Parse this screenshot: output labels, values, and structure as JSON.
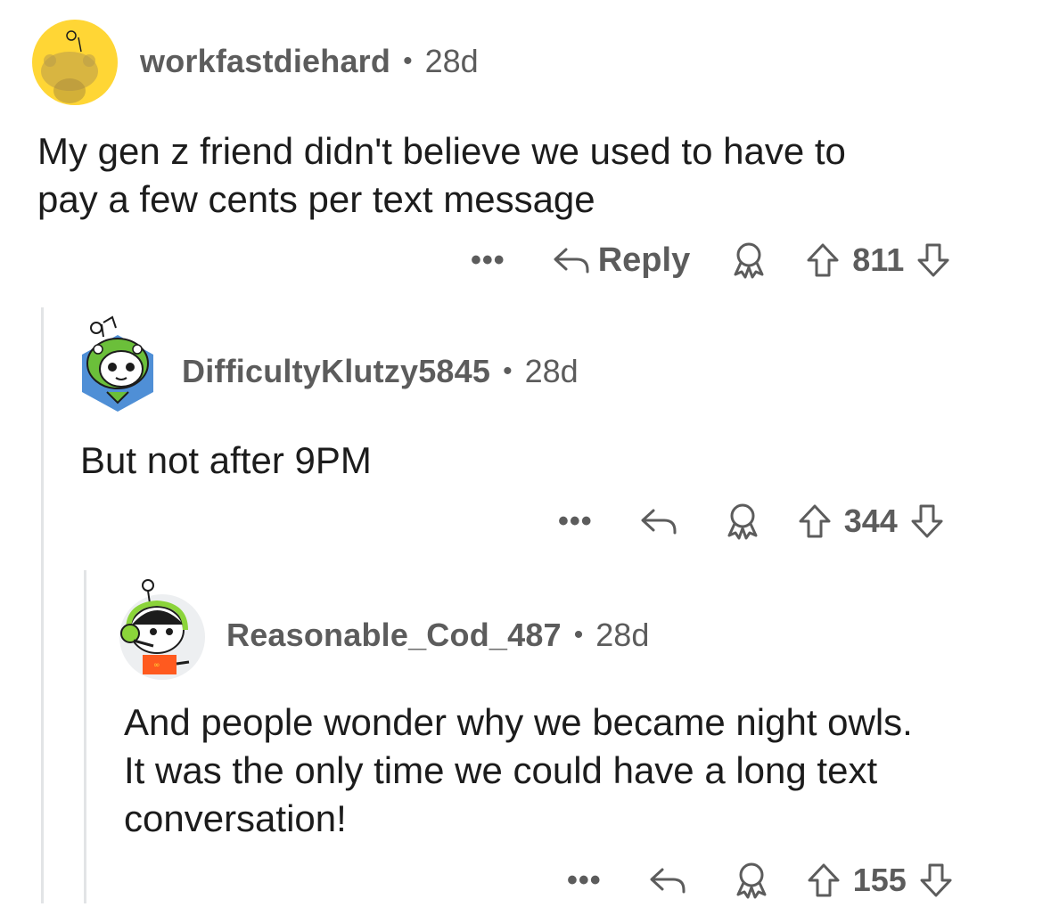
{
  "comments": [
    {
      "username": "workfastdiehard",
      "separator": "•",
      "age": "28d",
      "body_lines": [
        "My gen z friend didn't believe we used to have to",
        "pay a few cents per text message"
      ],
      "more": "•••",
      "reply_label": "Reply",
      "score": "811",
      "avatar_bg": "#FFD635"
    },
    {
      "username": "DifficultyKlutzy5845",
      "separator": "•",
      "age": "28d",
      "body_lines": [
        "But not after 9PM"
      ],
      "more": "•••",
      "score": "344",
      "avatar_bg": "#4F8FD6"
    },
    {
      "username": "Reasonable_Cod_487",
      "separator": "•",
      "age": "28d",
      "body_lines": [
        "And people wonder why we became night owls.",
        "It was the only time we could have a long text",
        "conversation!"
      ],
      "more": "•••",
      "score": "155",
      "avatar_bg": "#EDEFF1"
    }
  ],
  "colors": {
    "meta_text": "#5c5c5c",
    "body_text": "#1c1c1c",
    "thread_line": "#e2e4e6"
  },
  "icons": [
    "reply-icon",
    "award-icon",
    "upvote-icon",
    "downvote-icon",
    "more-icon"
  ]
}
